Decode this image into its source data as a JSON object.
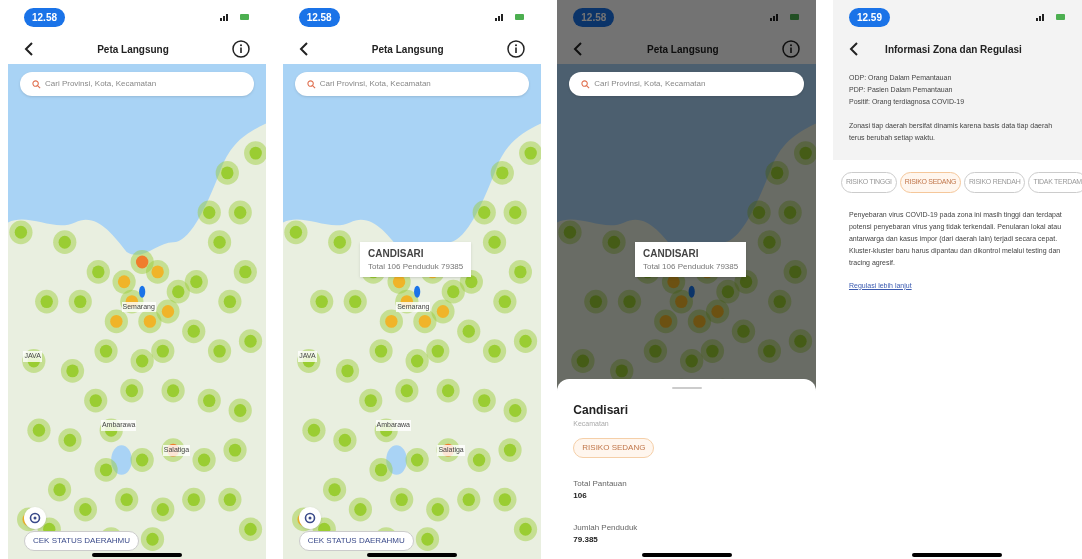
{
  "screens": [
    {
      "kind": "map",
      "time": "12.58",
      "title": "Peta Langsung",
      "search_placeholder": "Cari Provinsi, Kota, Kecamatan",
      "map_labels": [
        "JAVA",
        "Semarang",
        "Ambarawa",
        "Salatiga"
      ],
      "button": "CEK STATUS DAERAHMU"
    },
    {
      "kind": "map",
      "time": "12.58",
      "title": "Peta Langsung",
      "search_placeholder": "Cari Provinsi, Kota, Kecamatan",
      "map_labels": [
        "JAVA",
        "Semarang",
        "Ambarawa",
        "Salatiga"
      ],
      "tooltip": {
        "title": "CANDISARI",
        "detail": "Total 106  Penduduk  79385"
      },
      "button": "CEK STATUS DAERAHMU"
    },
    {
      "kind": "sheet",
      "time": "12.58",
      "title": "Peta Langsung",
      "search_placeholder": "Cari Provinsi, Kota, Kecamatan",
      "tooltip": {
        "title": "CANDISARI",
        "detail": "Total 106  Penduduk  79385"
      },
      "sheet": {
        "name": "Candisari",
        "type": "Kecamatan",
        "badge": "RISIKO SEDANG",
        "stats": [
          {
            "label": "Total Pantauan",
            "value": "106"
          },
          {
            "label": "Jumlah Penduduk",
            "value": "79.385"
          }
        ]
      }
    },
    {
      "kind": "info",
      "time": "12.59",
      "title": "Informasi Zona dan Regulasi",
      "definitions": [
        "ODP: Orang Dalam Pemantauan",
        "PDP: Pasien Dalam Pemantauan",
        "Positif: Orang terdiagnosa COVID-19"
      ],
      "note": "Zonasi tiap daerah bersifat dinamis karena basis data tiap daerah terus berubah setiap waktu.",
      "chips": [
        {
          "label": "RISIKO TINGGI",
          "selected": false
        },
        {
          "label": "RISIKO SEDANG",
          "selected": true
        },
        {
          "label": "RISIKO RENDAH",
          "selected": false
        },
        {
          "label": "TIDAK TERDAM",
          "selected": false
        }
      ],
      "description": "Penyebaran virus COVID-19 pada zona ini masih tinggi dan terdapat potensi penyebaran virus yang tidak terkendali. Penularan lokal atau antarwarga dan kasus impor (dari daerah lain) terjadi secara cepat. Kluster-kluster baru harus dipantau dan dikontrol melalui testing dan tracing agresif.",
      "link": "Regulasi lebih lanjut"
    }
  ]
}
